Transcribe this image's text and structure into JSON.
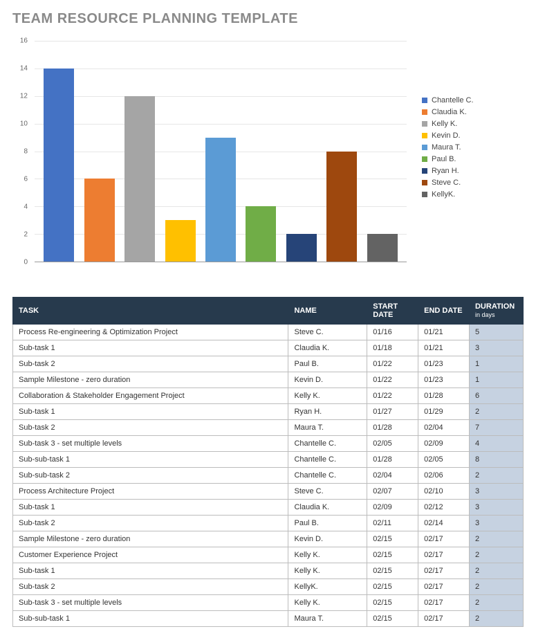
{
  "title": "TEAM RESOURCE PLANNING TEMPLATE",
  "chart_data": {
    "type": "bar",
    "ylim": [
      0,
      16
    ],
    "yticks": [
      0,
      2,
      4,
      6,
      8,
      10,
      12,
      14,
      16
    ],
    "series": [
      {
        "name": "Chantelle C.",
        "value": 14,
        "color": "#4472c4"
      },
      {
        "name": "Claudia K.",
        "value": 6,
        "color": "#ed7d31"
      },
      {
        "name": "Kelly K.",
        "value": 12,
        "color": "#a5a5a5"
      },
      {
        "name": "Kevin D.",
        "value": 3,
        "color": "#ffc000"
      },
      {
        "name": "Maura T.",
        "value": 9,
        "color": "#5b9bd5"
      },
      {
        "name": "Paul B.",
        "value": 4,
        "color": "#70ad47"
      },
      {
        "name": "Ryan H.",
        "value": 2,
        "color": "#264478"
      },
      {
        "name": "Steve C.",
        "value": 8,
        "color": "#9e480e"
      },
      {
        "name": "KellyK.",
        "value": 2,
        "color": "#636363"
      }
    ]
  },
  "table": {
    "headers": {
      "task": "TASK",
      "name": "NAME",
      "start": "START DATE",
      "end": "END DATE",
      "duration": "DURATION",
      "duration_unit": "in days"
    },
    "rows": [
      {
        "task": "Process Re-engineering & Optimization Project",
        "name": "Steve C.",
        "start": "01/16",
        "end": "01/21",
        "dur": "5"
      },
      {
        "task": "Sub-task 1",
        "name": "Claudia K.",
        "start": "01/18",
        "end": "01/21",
        "dur": "3"
      },
      {
        "task": "Sub-task 2",
        "name": "Paul B.",
        "start": "01/22",
        "end": "01/23",
        "dur": "1"
      },
      {
        "task": "Sample Milestone - zero duration",
        "name": "Kevin D.",
        "start": "01/22",
        "end": "01/23",
        "dur": "1"
      },
      {
        "task": "Collaboration & Stakeholder Engagement Project",
        "name": "Kelly K.",
        "start": "01/22",
        "end": "01/28",
        "dur": "6"
      },
      {
        "task": "Sub-task 1",
        "name": "Ryan H.",
        "start": "01/27",
        "end": "01/29",
        "dur": "2"
      },
      {
        "task": "Sub-task 2",
        "name": "Maura T.",
        "start": "01/28",
        "end": "02/04",
        "dur": "7"
      },
      {
        "task": "Sub-task 3 - set multiple levels",
        "name": "Chantelle C.",
        "start": "02/05",
        "end": "02/09",
        "dur": "4"
      },
      {
        "task": "Sub-sub-task 1",
        "name": "Chantelle C.",
        "start": "01/28",
        "end": "02/05",
        "dur": "8"
      },
      {
        "task": "Sub-sub-task 2",
        "name": "Chantelle C.",
        "start": "02/04",
        "end": "02/06",
        "dur": "2"
      },
      {
        "task": "Process Architecture Project",
        "name": "Steve C.",
        "start": "02/07",
        "end": "02/10",
        "dur": "3"
      },
      {
        "task": "Sub-task 1",
        "name": "Claudia K.",
        "start": "02/09",
        "end": "02/12",
        "dur": "3"
      },
      {
        "task": "Sub-task 2",
        "name": "Paul B.",
        "start": "02/11",
        "end": "02/14",
        "dur": "3"
      },
      {
        "task": "Sample Milestone - zero duration",
        "name": "Kevin D.",
        "start": "02/15",
        "end": "02/17",
        "dur": "2"
      },
      {
        "task": "Customer Experience Project",
        "name": "Kelly K.",
        "start": "02/15",
        "end": "02/17",
        "dur": "2"
      },
      {
        "task": "Sub-task 1",
        "name": "Kelly K.",
        "start": "02/15",
        "end": "02/17",
        "dur": "2"
      },
      {
        "task": "Sub-task 2",
        "name": "KellyK.",
        "start": "02/15",
        "end": "02/17",
        "dur": "2"
      },
      {
        "task": "Sub-task 3 - set multiple levels",
        "name": "Kelly K.",
        "start": "02/15",
        "end": "02/17",
        "dur": "2"
      },
      {
        "task": "Sub-sub-task 1",
        "name": "Maura T.",
        "start": "02/15",
        "end": "02/17",
        "dur": "2"
      }
    ]
  }
}
